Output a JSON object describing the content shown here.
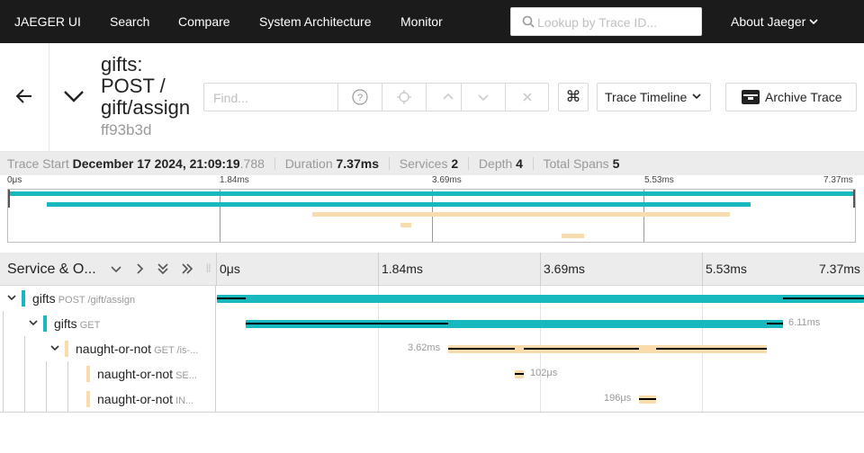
{
  "nav": {
    "brand": "JAEGER UI",
    "items": [
      "Search",
      "Compare",
      "System Architecture",
      "Monitor"
    ],
    "search_placeholder": "Lookup by Trace ID...",
    "about": "About Jaeger"
  },
  "trace": {
    "title": "gifts: POST / gift/assign",
    "id": "ff93b3d",
    "find_placeholder": "Find...",
    "view_select": "Trace Timeline",
    "archive_label": "Archive Trace"
  },
  "summary": {
    "trace_start_label": "Trace Start",
    "trace_start_value": "December 17 2024, 21:09:19",
    "trace_start_ms": ".788",
    "duration_label": "Duration",
    "duration_value": "7.37ms",
    "services_label": "Services",
    "services_value": "2",
    "depth_label": "Depth",
    "depth_value": "4",
    "spans_label": "Total Spans",
    "spans_value": "5"
  },
  "minimap_ticks": [
    "0μs",
    "1.84ms",
    "3.69ms",
    "5.53ms",
    "7.37ms"
  ],
  "timeline": {
    "column_title": "Service & O...",
    "ticks": [
      "0μs",
      "1.84ms",
      "3.69ms",
      "5.53ms",
      "7.37ms"
    ]
  },
  "colors": {
    "gifts": "#17b8be",
    "naught_or_not": "#f8dcae"
  },
  "spans": [
    {
      "service": "gifts",
      "operation": "POST /gift/assign",
      "duration": ""
    },
    {
      "service": "gifts",
      "operation": "GET",
      "duration": "6.11ms"
    },
    {
      "service": "naught-or-not",
      "operation": "GET /is-...",
      "duration": "3.62ms"
    },
    {
      "service": "naught-or-not",
      "operation": "SE...",
      "duration": "102μs"
    },
    {
      "service": "naught-or-not",
      "operation": "IN...",
      "duration": "196μs"
    }
  ]
}
